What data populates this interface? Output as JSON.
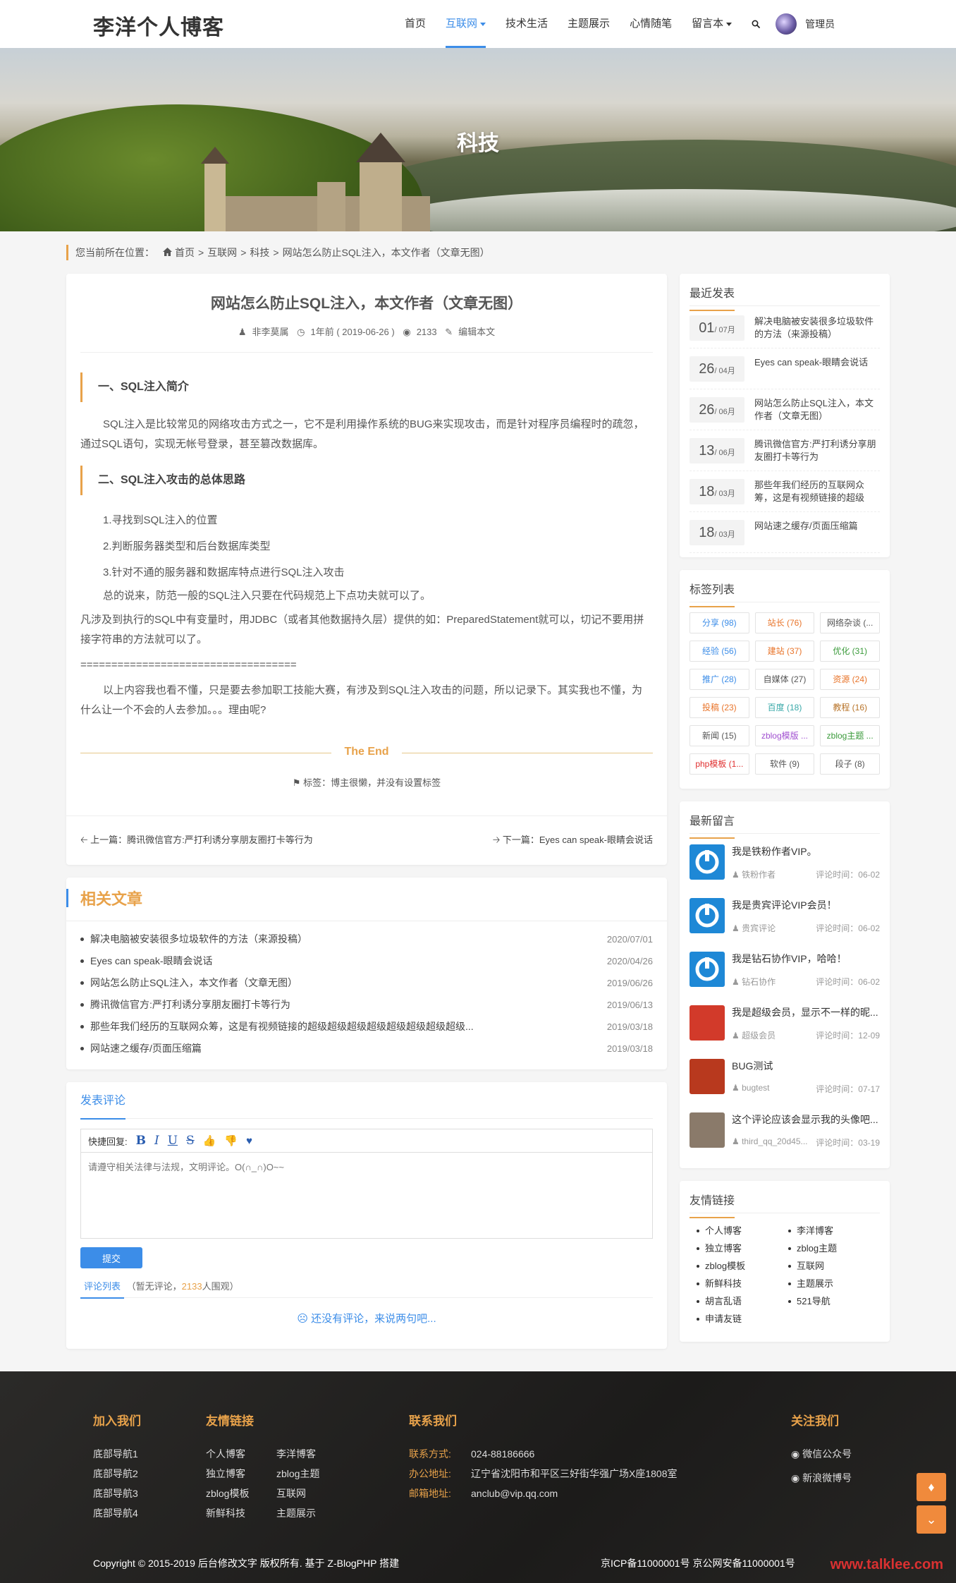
{
  "site": {
    "logo": "李洋个人博客"
  },
  "nav": {
    "items": [
      "首页",
      "互联网",
      "技术生活",
      "主题展示",
      "心情随笔",
      "留言本"
    ],
    "user": "管理员"
  },
  "banner": {
    "title": "科技"
  },
  "breadcrumb": {
    "prefix": "您当前所在位置：",
    "home": "首页",
    "c1": "互联网",
    "c2": "科技",
    "current": "网站怎么防止SQL注入，本文作者（文章无图）",
    "sep": ">"
  },
  "article": {
    "title": "网站怎么防止SQL注入，本文作者（文章无图）",
    "author": "非李莫属",
    "time": "1年前 ( 2019-06-26 )",
    "views": "2133",
    "edit": "编辑本文",
    "sec1": "一、SQL注入简介",
    "p1": "SQL注入是比较常见的网络攻击方式之一，它不是利用操作系统的BUG来实现攻击，而是针对程序员编程时的疏忽，通过SQL语句，实现无帐号登录，甚至篡改数据库。",
    "sec2": "二、SQL注入攻击的总体思路",
    "l1": "1.寻找到SQL注入的位置",
    "l2": "2.判断服务器类型和后台数据库类型",
    "l3": "3.针对不通的服务器和数据库特点进行SQL注入攻击",
    "p2": "总的说来，防范一般的SQL注入只要在代码规范上下点功夫就可以了。",
    "p3": "凡涉及到执行的SQL中有变量时，用JDBC（或者其他数据持久层）提供的如：PreparedStatement就可以，切记不要用拼接字符串的方法就可以了。",
    "p4": "===================================",
    "p5": "以上内容我也看不懂，只是要去参加职工技能大赛，有涉及到SQL注入攻击的问题，所以记录下。其实我也不懂，为什么让一个不会的人去参加。。。理由呢?",
    "end": "The End",
    "tags": "标签：博主很懒，并没有设置标签",
    "prev": "上一篇：腾讯微信官方:严打利诱分享朋友圈打卡等行为",
    "next": "下一篇：Eyes can speak-眼睛会说话"
  },
  "related": {
    "title": "相关文章",
    "items": [
      {
        "t": "解决电脑被安装很多垃圾软件的方法（来源投稿）",
        "d": "2020/07/01"
      },
      {
        "t": "Eyes can speak-眼睛会说话",
        "d": "2020/04/26"
      },
      {
        "t": "网站怎么防止SQL注入，本文作者（文章无图）",
        "d": "2019/06/26"
      },
      {
        "t": "腾讯微信官方:严打利诱分享朋友圈打卡等行为",
        "d": "2019/06/13"
      },
      {
        "t": "那些年我们经历的互联网众筹，这是有视频链接的超级超级超级超级超级超级超级超级...",
        "d": "2019/03/18"
      },
      {
        "t": "网站速之缓存/页面压缩篇",
        "d": "2019/03/18"
      }
    ]
  },
  "comment": {
    "title": "发表评论",
    "quick": "快捷回复:",
    "placeholder": "请遵守相关法律与法规，文明评论。O(∩_∩)O~~",
    "submit": "提交",
    "list_label": "评论列表",
    "list_pre": "（暂无评论，",
    "list_num": "2133",
    "list_post": "人围观）",
    "none": "还没有评论，来说两句吧..."
  },
  "recent": {
    "title": "最近发表",
    "items": [
      {
        "d": "01",
        "m": "/ 07月",
        "t": "解决电脑被安装很多垃圾软件的方法（来源投稿）"
      },
      {
        "d": "26",
        "m": "/ 04月",
        "t": "Eyes can speak-眼睛会说话"
      },
      {
        "d": "26",
        "m": "/ 06月",
        "t": "网站怎么防止SQL注入，本文作者（文章无图）"
      },
      {
        "d": "13",
        "m": "/ 06月",
        "t": "腾讯微信官方:严打利诱分享朋友圈打卡等行为"
      },
      {
        "d": "18",
        "m": "/ 03月",
        "t": "那些年我们经历的互联网众筹，这是有视频链接的超级"
      },
      {
        "d": "18",
        "m": "/ 03月",
        "t": "网站速之缓存/页面压缩篇"
      }
    ]
  },
  "tags": {
    "title": "标签列表",
    "items": [
      {
        "t": "分享 (98)",
        "c": "#3c8de8"
      },
      {
        "t": "站长 (76)",
        "c": "#e8742a"
      },
      {
        "t": "网络杂谈 (...",
        "c": "#555555"
      },
      {
        "t": "经验 (56)",
        "c": "#3c8de8"
      },
      {
        "t": "建站 (37)",
        "c": "#e8742a"
      },
      {
        "t": "优化 (31)",
        "c": "#3a9a3a"
      },
      {
        "t": "推广 (28)",
        "c": "#3c8de8"
      },
      {
        "t": "自媒体 (27)",
        "c": "#555555"
      },
      {
        "t": "资源 (24)",
        "c": "#e8742a"
      },
      {
        "t": "投稿 (23)",
        "c": "#e8742a"
      },
      {
        "t": "百度 (18)",
        "c": "#3aa9a9"
      },
      {
        "t": "教程 (16)",
        "c": "#b8742a"
      },
      {
        "t": "新闻 (15)",
        "c": "#555555"
      },
      {
        "t": "zblog模版 ...",
        "c": "#a04fd0"
      },
      {
        "t": "zblog主题 ...",
        "c": "#3a9a3a"
      },
      {
        "t": "php模板 (1...",
        "c": "#e03030"
      },
      {
        "t": "软件 (9)",
        "c": "#555555"
      },
      {
        "t": "段子 (8)",
        "c": "#555555"
      }
    ]
  },
  "messages": {
    "title": "最新留言",
    "items": [
      {
        "c": "我是铁粉作者VIP。",
        "u": "铁粉作者",
        "t": "评论时间：06-02",
        "bg": "#1e88d6"
      },
      {
        "c": "我是贵宾评论VIP会员！",
        "u": "贵宾评论",
        "t": "评论时间：06-02",
        "bg": "#1e88d6"
      },
      {
        "c": "我是钻石协作VIP，哈哈！",
        "u": "钻石协作",
        "t": "评论时间：06-02",
        "bg": "#1e88d6"
      },
      {
        "c": "我是超级会员，显示不一样的昵...",
        "u": "超级会员",
        "t": "评论时间：12-09",
        "bg": "#d23a2a"
      },
      {
        "c": "BUG测试",
        "u": "bugtest",
        "t": "评论时间：07-17",
        "bg": "#b8391e"
      },
      {
        "c": "这个评论应该会显示我的头像吧...",
        "u": "third_qq_20d45...",
        "t": "评论时间：03-19",
        "bg": "#8a7a6a"
      }
    ]
  },
  "friends": {
    "title": "友情链接",
    "items": [
      "个人博客",
      "李洋博客",
      "独立博客",
      "zblog主题",
      "zblog模板",
      "互联网",
      "新鲜科技",
      "主题展示",
      "胡言乱语",
      "521导航",
      "申请友链"
    ]
  },
  "footer": {
    "join": "加入我们",
    "join_items": [
      "底部导航1",
      "底部导航2",
      "底部导航3",
      "底部导航4"
    ],
    "links": "友情链接",
    "link_items": [
      "个人博客",
      "李洋博客",
      "独立博客",
      "zblog主题",
      "zblog模板",
      "互联网",
      "新鲜科技",
      "主题展示"
    ],
    "contact": "联系我们",
    "c1_l": "联系方式:",
    "c1_v": "024-88186666",
    "c2_l": "办公地址:",
    "c2_v": "辽宁省沈阳市和平区三好街华强广场X座1808室",
    "c3_l": "邮箱地址:",
    "c3_v": "anclub@vip.qq.com",
    "follow": "关注我们",
    "wechat": "微信公众号",
    "weibo": "新浪微博号",
    "copyright": "Copyright © 2015-2019 后台修改文字 版权所有. 基于 Z-BlogPHP 搭建",
    "icp": "京ICP备11000001号  京公网安备11000001号",
    "watermark": "www.talklee.com"
  }
}
